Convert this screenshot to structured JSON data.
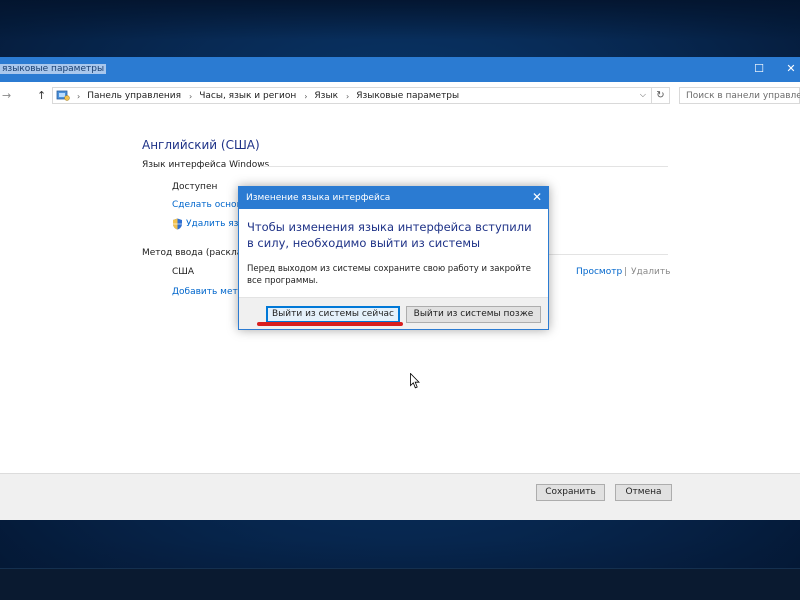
{
  "window": {
    "title": "языковые параметры",
    "maximize_glyph": "☐",
    "close_glyph": "✕"
  },
  "nav": {
    "back_glyph": "→",
    "up_glyph": "↑",
    "breadcrumbs": [
      "Панель управления",
      "Часы, язык и регион",
      "Язык",
      "Языковые параметры"
    ],
    "crumb_separator": "›",
    "dropdown_glyph": "⌵",
    "refresh_glyph": "↻",
    "search_placeholder": "Поиск в панели управлени"
  },
  "content": {
    "language_title": "Английский (США)",
    "ui_language_label": "Язык интерфейса Windows",
    "available_text": "Доступен",
    "make_primary_link": "Сделать основ",
    "remove_language_link": "Удалить язы",
    "input_method_label": "Метод ввода (расклад",
    "input_method_value": "США",
    "preview_link": "Просмотр",
    "link_divider": "|",
    "remove_link": "Удалить",
    "add_input_method_link": "Добавить метод"
  },
  "footer": {
    "save_label": "Сохранить",
    "cancel_label": "Отмена"
  },
  "dialog": {
    "title": "Изменение языка интерфейса",
    "close_glyph": "✕",
    "heading": "Чтобы изменения языка интерфейса вступили в силу, необходимо выйти из системы",
    "body": "Перед выходом из системы сохраните свою работу и закройте все программы.",
    "sign_out_now_label": "Выйти из системы сейчас",
    "sign_out_later_label": "Выйти из системы позже"
  },
  "colors": {
    "accent": "#2b7bd2",
    "heading_blue": "#1e3287",
    "link_blue": "#0066cc",
    "annotation_red": "#d91e1e"
  }
}
